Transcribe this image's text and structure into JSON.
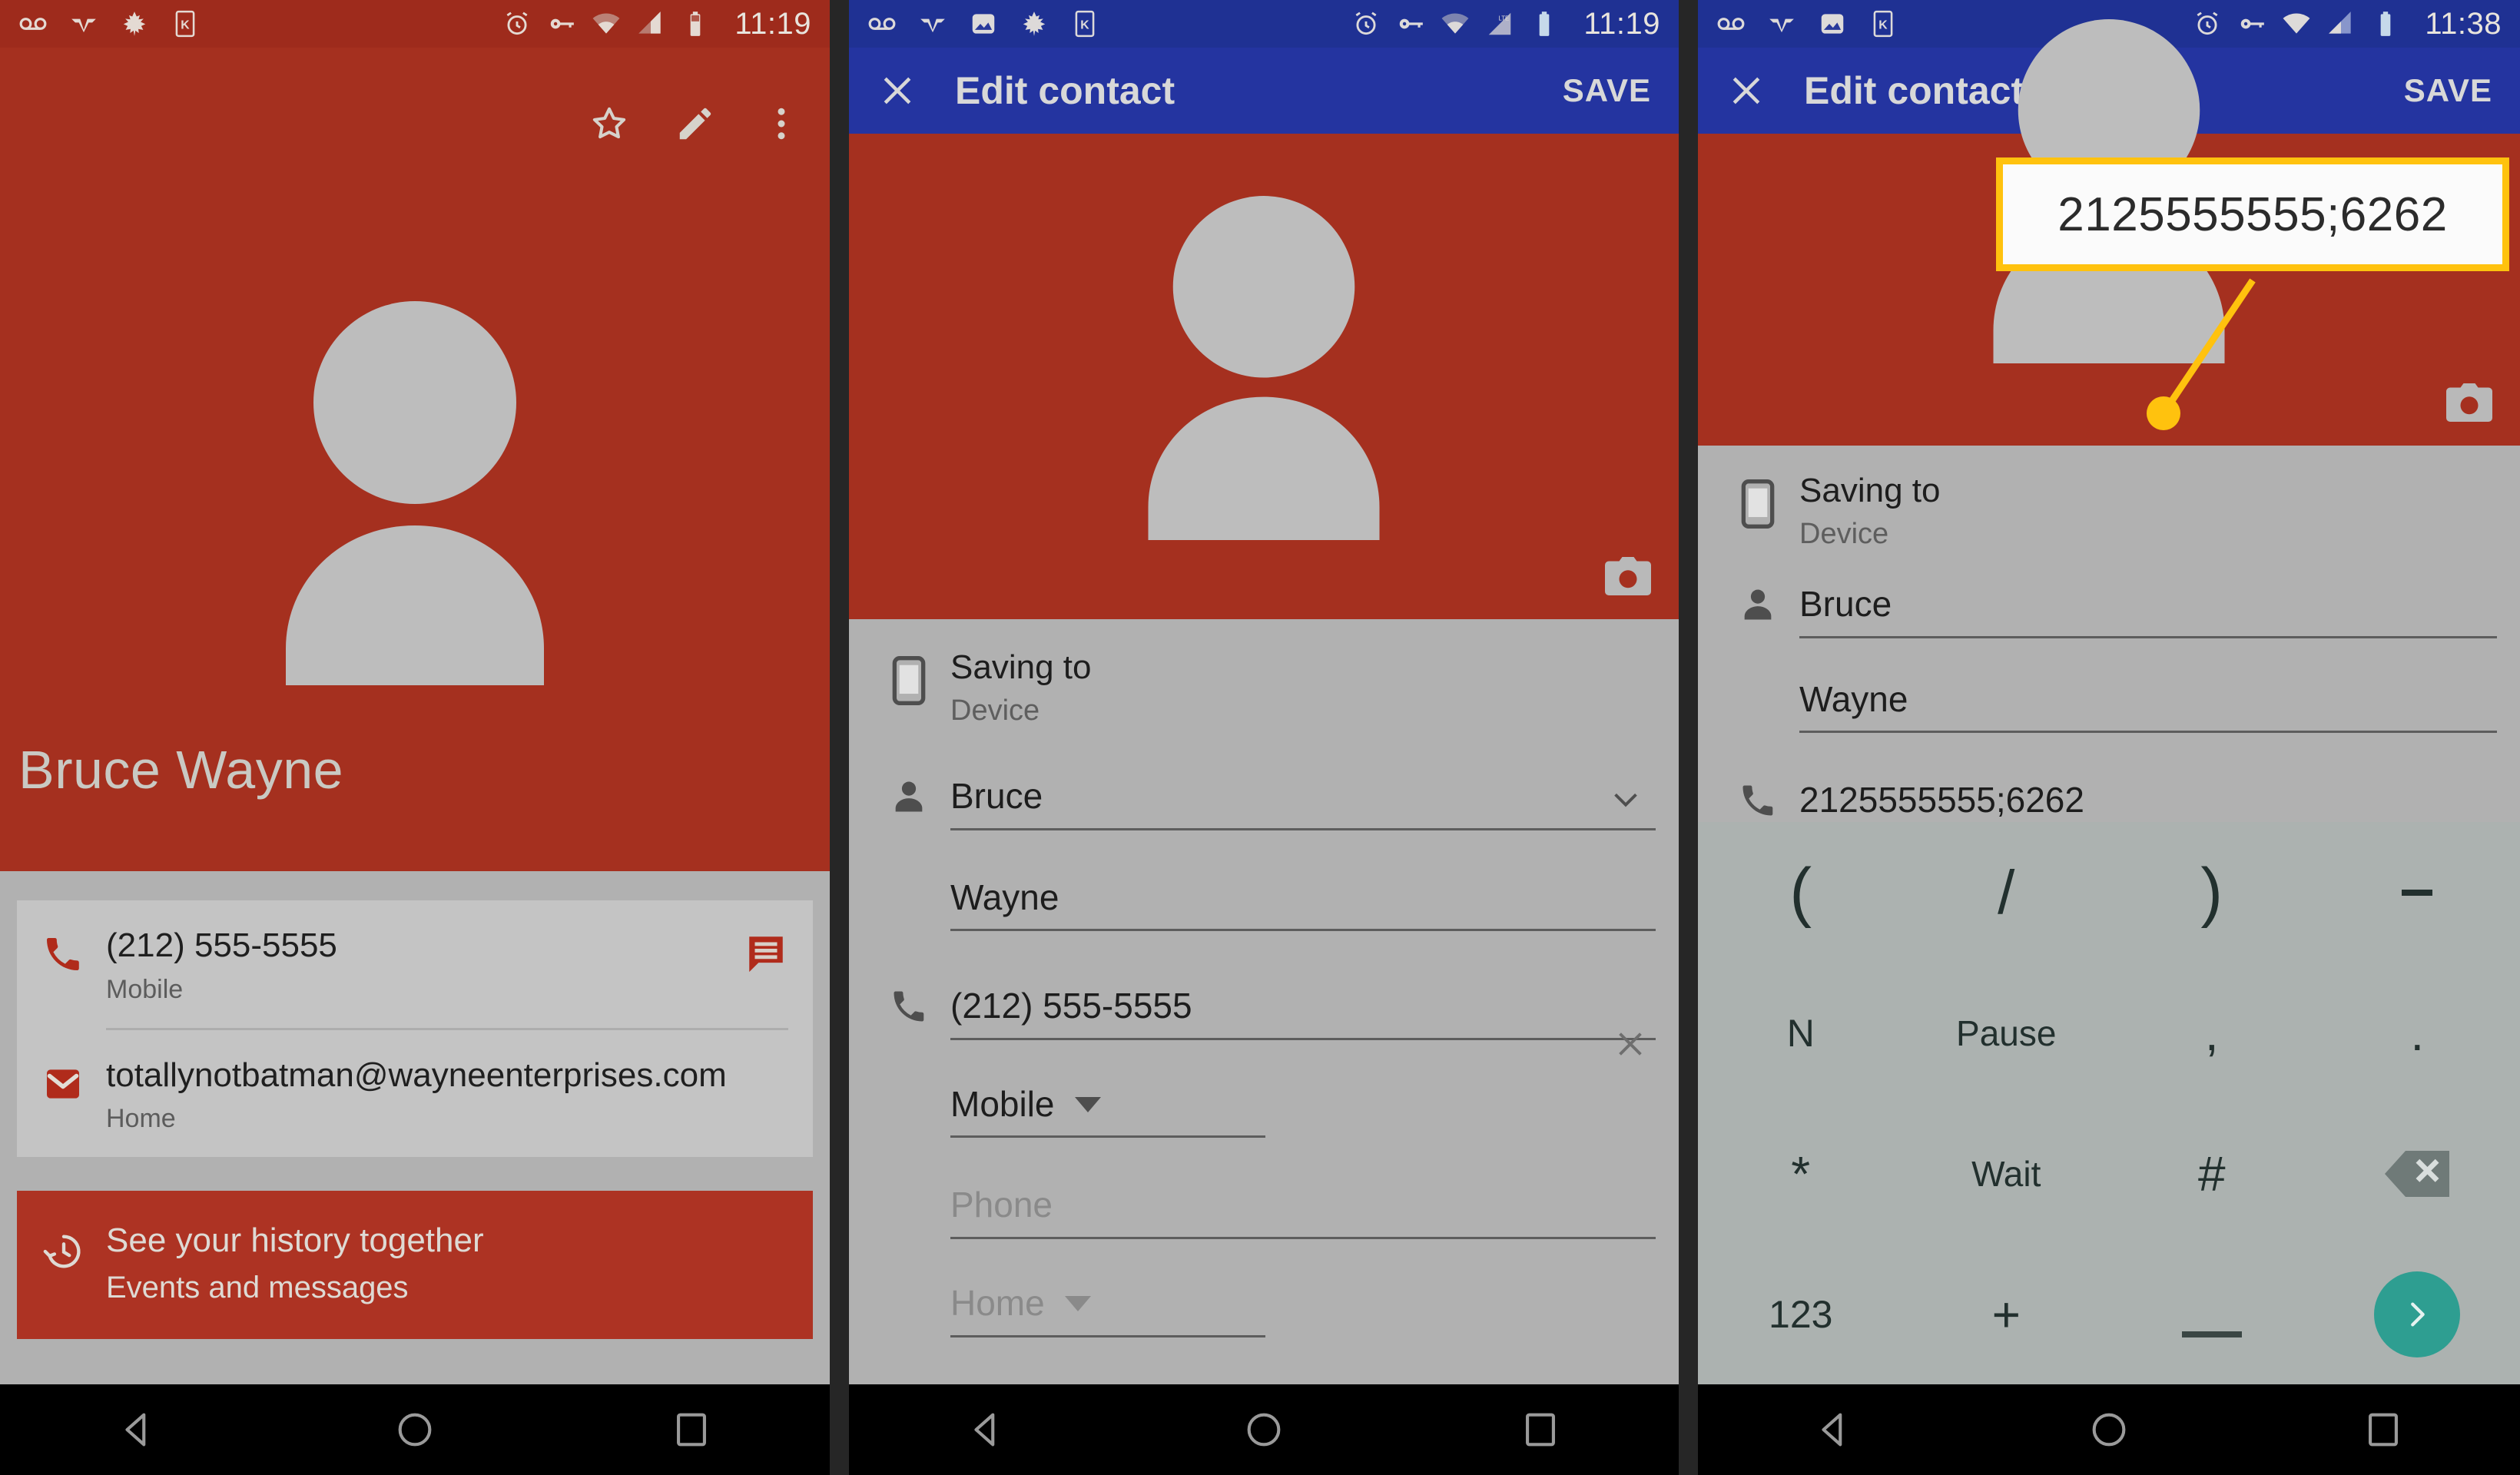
{
  "colors": {
    "brand_red": "#a5301f",
    "status_red": "#9e2b1c",
    "brand_blue": "#2434a0",
    "status_blue": "#1f3193",
    "form_gray": "#b1b1b1",
    "card_gray": "#c4c4c4",
    "keyboard_gray": "#acb2b0",
    "callout_yellow": "#ffc20e",
    "enter_teal": "#2e9e91",
    "history_red": "#ad3323"
  },
  "panel1": {
    "statusbar": {
      "left_icons": [
        "voicemail-icon",
        "vpn-wings-icon",
        "maple-leaf-icon",
        "k-card-icon"
      ],
      "right_icons": [
        "alarm-icon",
        "vpn-key-icon",
        "wifi-icon",
        "signal-icon",
        "battery-icon"
      ],
      "time": "11:19"
    },
    "actions": [
      "star-outline-icon",
      "edit-pencil-icon",
      "overflow-menu-icon"
    ],
    "contact_name": "Bruce Wayne",
    "rows": [
      {
        "icon": "phone-icon",
        "title": "(212) 555-5555",
        "subtitle": "Mobile",
        "end_icon": "sms-message-icon"
      },
      {
        "icon": "email-icon",
        "title": "totallynotbatman@wayneenterprises.com",
        "subtitle": "Home",
        "end_icon": ""
      }
    ],
    "history": {
      "icon": "history-clock-icon",
      "title": "See your history together",
      "subtitle": "Events and messages"
    },
    "navbar": [
      "back-triangle-icon",
      "home-circle-icon",
      "recents-square-icon"
    ]
  },
  "panel2": {
    "statusbar": {
      "left_icons": [
        "voicemail-icon",
        "vpn-wings-icon",
        "photo-icon",
        "maple-leaf-icon",
        "k-card-icon"
      ],
      "right_icons": [
        "alarm-icon",
        "vpn-key-icon",
        "wifi-icon",
        "signal-lte-icon",
        "battery-icon"
      ],
      "time": "11:19"
    },
    "appbar": {
      "close_icon": "close-x-icon",
      "title": "Edit contact",
      "save_label": "SAVE"
    },
    "hero": {
      "avatar_icon": "person-avatar-icon",
      "camera_icon": "camera-icon"
    },
    "saving_to": {
      "icon": "device-phone-icon",
      "label": "Saving to",
      "value": "Device"
    },
    "name_section": {
      "icon": "person-icon",
      "expand_icon": "chevron-down-icon",
      "first_name": "Bruce",
      "last_name": "Wayne"
    },
    "phone_section": {
      "icon": "phone-icon",
      "phone1_value": "(212) 555-5555",
      "phone1_clear_icon": "close-x-icon",
      "phone1_type": "Mobile",
      "phone2_placeholder": "Phone",
      "phone2_type": "Home"
    },
    "navbar": [
      "back-triangle-icon",
      "home-circle-icon",
      "recents-square-icon"
    ]
  },
  "panel3": {
    "statusbar": {
      "left_icons": [
        "voicemail-icon",
        "vpn-wings-icon",
        "photo-icon",
        "k-card-icon"
      ],
      "right_icons": [
        "alarm-icon",
        "vpn-key-icon",
        "wifi-icon",
        "signal-icon",
        "battery-icon"
      ],
      "time": "11:38"
    },
    "appbar": {
      "close_icon": "close-x-icon",
      "title": "Edit contact",
      "save_label": "SAVE"
    },
    "hero": {
      "avatar_icon": "person-avatar-icon",
      "camera_icon": "camera-icon"
    },
    "saving_to": {
      "icon": "device-phone-icon",
      "label": "Saving to",
      "value": "Device"
    },
    "name_section": {
      "icon": "person-icon",
      "first_name": "Bruce",
      "last_name": "Wayne"
    },
    "phone_section": {
      "icon": "phone-icon",
      "phone_value": "2125555555;6262"
    },
    "callout": {
      "text": "2125555555;6262"
    },
    "keyboard": {
      "rows": [
        [
          {
            "label": "(",
            "name": "key-open-paren",
            "kind": "paren"
          },
          {
            "label": "/",
            "name": "key-slash",
            "kind": "slash"
          },
          {
            "label": ")",
            "name": "key-close-paren",
            "kind": "paren"
          },
          {
            "label": "-",
            "name": "key-dash",
            "kind": "dash"
          }
        ],
        [
          {
            "label": "N",
            "name": "key-n",
            "kind": "small"
          },
          {
            "label": "Pause",
            "name": "key-pause",
            "kind": "word"
          },
          {
            "label": ",",
            "name": "key-comma",
            "kind": "char"
          },
          {
            "label": ".",
            "name": "key-period",
            "kind": "char"
          }
        ],
        [
          {
            "label": "*",
            "name": "key-asterisk",
            "kind": "char"
          },
          {
            "label": "Wait",
            "name": "key-wait",
            "kind": "word"
          },
          {
            "label": "#",
            "name": "key-hash",
            "kind": "char"
          },
          {
            "label": "",
            "name": "key-backspace",
            "kind": "backspace"
          }
        ],
        [
          {
            "label": "123",
            "name": "key-123",
            "kind": "small"
          },
          {
            "label": "+",
            "name": "key-plus",
            "kind": "char"
          },
          {
            "label": "",
            "name": "key-underscore",
            "kind": "underscore"
          },
          {
            "label": "",
            "name": "key-enter",
            "kind": "enter"
          }
        ]
      ]
    },
    "navbar": [
      "back-triangle-icon",
      "home-circle-icon",
      "recents-square-icon"
    ]
  }
}
